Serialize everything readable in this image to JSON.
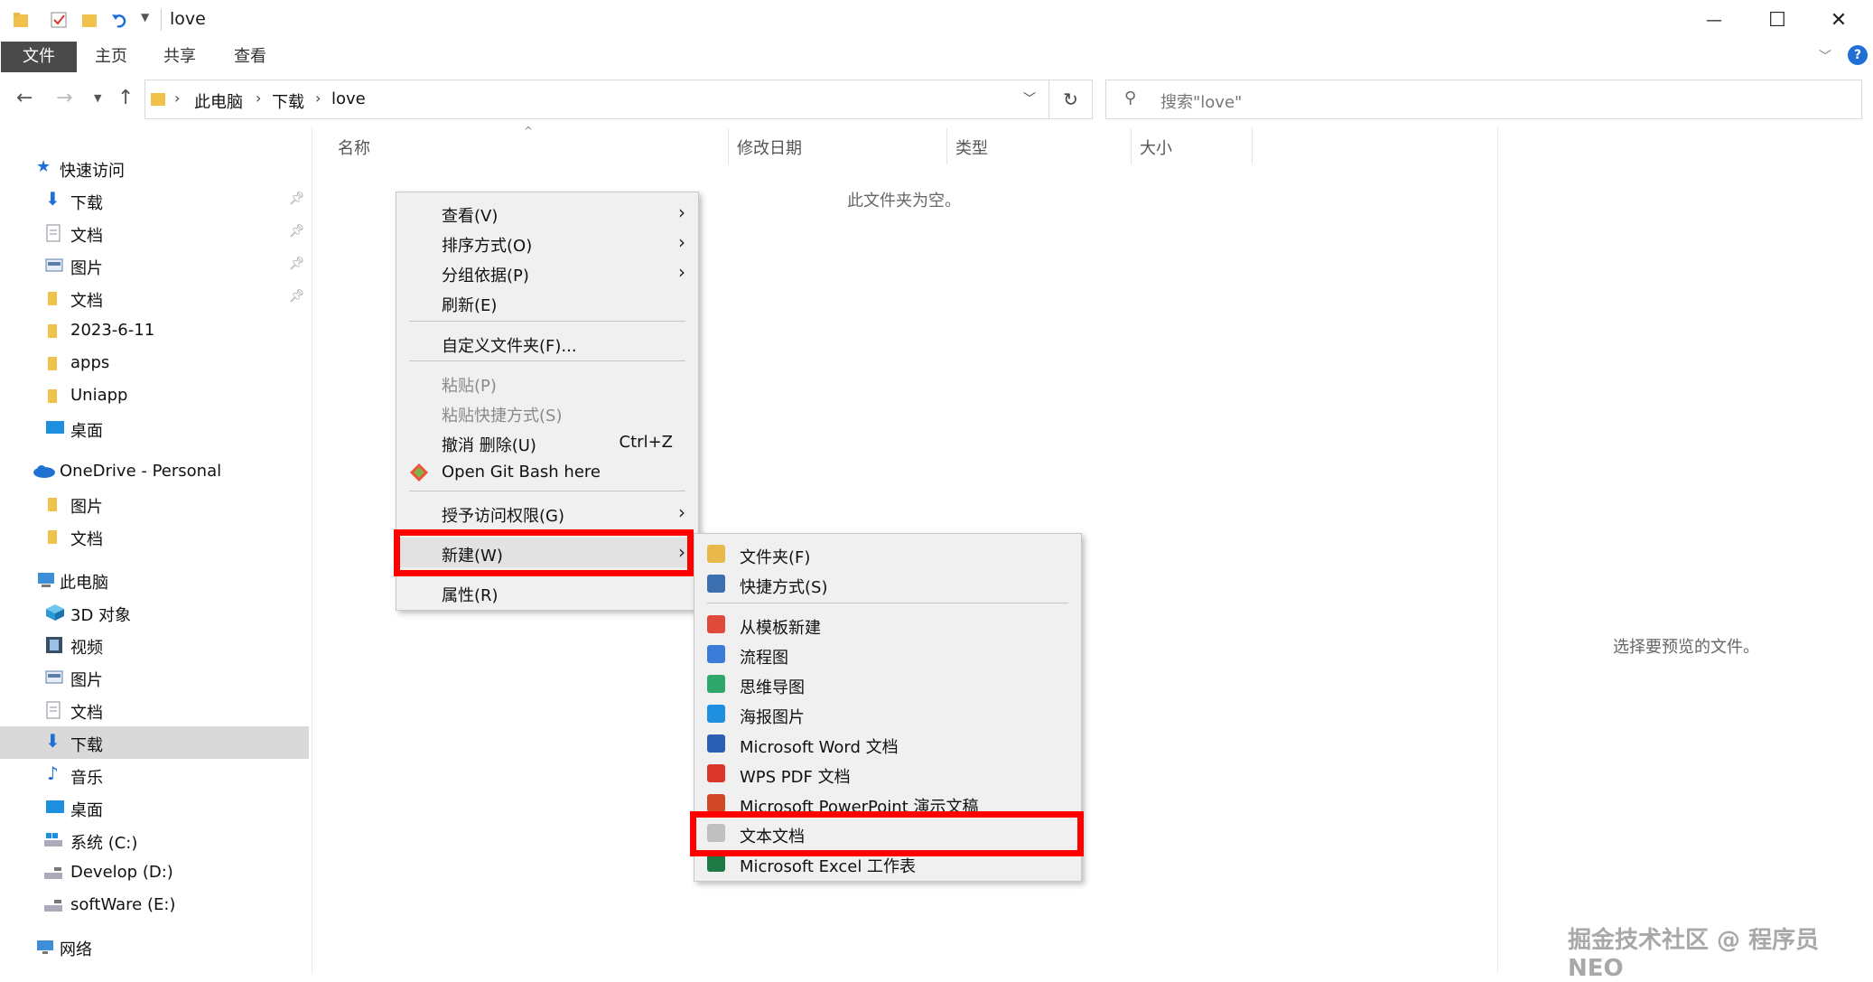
{
  "window": {
    "title": "love",
    "minimize_glyph": "—",
    "maximize_glyph": "☐",
    "close_glyph": "✕"
  },
  "ribbon": {
    "tabs": [
      "文件",
      "主页",
      "共享",
      "查看"
    ]
  },
  "address": {
    "crumbs": [
      "此电脑",
      "下载",
      "love"
    ],
    "search_placeholder": "搜索\"love\""
  },
  "sidebar": {
    "quick_access": "快速访问",
    "quick_items": [
      "下载",
      "文档",
      "图片",
      "文档",
      "2023-6-11",
      "apps",
      "Uniapp",
      "桌面"
    ],
    "onedrive": "OneDrive - Personal",
    "onedrive_items": [
      "图片",
      "文档"
    ],
    "this_pc": "此电脑",
    "pc_items": [
      "3D 对象",
      "视频",
      "图片",
      "文档",
      "下载",
      "音乐",
      "桌面",
      "系统 (C:)",
      "Develop (D:)",
      "softWare (E:)"
    ],
    "network": "网络",
    "selected": "下载"
  },
  "columns": [
    "名称",
    "修改日期",
    "类型",
    "大小"
  ],
  "empty_message": "此文件夹为空。",
  "preview_message": "选择要预览的文件。",
  "context_menu": {
    "items": [
      {
        "label": "查看(V)",
        "submenu": true
      },
      {
        "label": "排序方式(O)",
        "submenu": true
      },
      {
        "label": "分组依据(P)",
        "submenu": true
      },
      {
        "label": "刷新(E)"
      },
      {
        "label": "自定义文件夹(F)..."
      },
      {
        "label": "粘贴(P)",
        "disabled": true
      },
      {
        "label": "粘贴快捷方式(S)",
        "disabled": true
      },
      {
        "label": "撤消 删除(U)",
        "shortcut": "Ctrl+Z"
      },
      {
        "label": "Open Git Bash here"
      },
      {
        "label": "授予访问权限(G)",
        "submenu": true
      },
      {
        "label": "新建(W)",
        "submenu": true
      },
      {
        "label": "属性(R)"
      }
    ]
  },
  "new_submenu": {
    "items": [
      {
        "label": "文件夹(F)",
        "color": "#e8b94a"
      },
      {
        "label": "快捷方式(S)",
        "color": "#3c6fb0"
      },
      {
        "label": "从模板新建",
        "color": "#e04a3a"
      },
      {
        "label": "流程图",
        "color": "#3c7bd8"
      },
      {
        "label": "思维导图",
        "color": "#2ea86a"
      },
      {
        "label": "海报图片",
        "color": "#1f8fe0"
      },
      {
        "label": "Microsoft Word 文档",
        "color": "#2b5fb4"
      },
      {
        "label": "WPS PDF 文档",
        "color": "#d9352b"
      },
      {
        "label": "Microsoft PowerPoint 演示文稿",
        "color": "#d24726"
      },
      {
        "label": "文本文档",
        "color": "#bfbfbf"
      },
      {
        "label": "Microsoft Excel 工作表",
        "color": "#1e7a45"
      }
    ]
  },
  "watermark": "掘金技术社区 @ 程序员NEO",
  "highlight_color": "#ff0000"
}
